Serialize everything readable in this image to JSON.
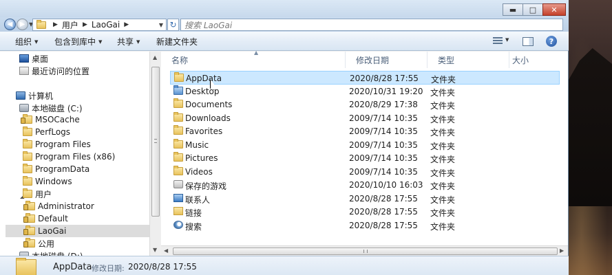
{
  "window": {
    "minimize_glyph": "▬",
    "maximize_glyph": "□",
    "close_glyph": "✕"
  },
  "address": {
    "segments": [
      "用户",
      "LaoGai"
    ],
    "search_placeholder": "搜索 LaoGai"
  },
  "toolbar": {
    "organize": "组织",
    "include_in_library": "包含到库中",
    "share": "共享",
    "new_folder": "新建文件夹",
    "help_glyph": "?"
  },
  "nav": {
    "items": [
      {
        "label": "桌面",
        "icon": "desktop-icon"
      },
      {
        "label": "最近访问的位置",
        "icon": "recent-places-icon"
      },
      {
        "label": "计算机",
        "icon": "computer-icon"
      },
      {
        "label": "本地磁盘 (C:)",
        "icon": "drive-icon"
      },
      {
        "label": "MSOCache",
        "icon": "locked-folder-icon"
      },
      {
        "label": "PerfLogs",
        "icon": "folder-icon"
      },
      {
        "label": "Program Files",
        "icon": "folder-icon"
      },
      {
        "label": "Program Files (x86)",
        "icon": "folder-icon"
      },
      {
        "label": "ProgramData",
        "icon": "folder-icon"
      },
      {
        "label": "Windows",
        "icon": "folder-icon"
      },
      {
        "label": "用户",
        "icon": "folder-icon"
      },
      {
        "label": "Administrator",
        "icon": "locked-folder-icon"
      },
      {
        "label": "Default",
        "icon": "locked-folder-icon"
      },
      {
        "label": "LaoGai",
        "icon": "locked-folder-icon"
      },
      {
        "label": "公用",
        "icon": "locked-folder-icon"
      },
      {
        "label": "本地磁盘 (D:)",
        "icon": "drive-icon"
      }
    ]
  },
  "columns": {
    "name": "名称",
    "date": "修改日期",
    "type": "类型",
    "size": "大小"
  },
  "files": [
    {
      "name": "AppData",
      "date": "2020/8/28 17:55",
      "type": "文件夹",
      "icon": "folder-icon",
      "selected": true
    },
    {
      "name": "Desktop",
      "date": "2020/10/31 19:20",
      "type": "文件夹",
      "icon": "desktop-folder-icon"
    },
    {
      "name": "Documents",
      "date": "2020/8/29 17:38",
      "type": "文件夹",
      "icon": "folder-icon"
    },
    {
      "name": "Downloads",
      "date": "2009/7/14 10:35",
      "type": "文件夹",
      "icon": "folder-icon"
    },
    {
      "name": "Favorites",
      "date": "2009/7/14 10:35",
      "type": "文件夹",
      "icon": "folder-icon"
    },
    {
      "name": "Music",
      "date": "2009/7/14 10:35",
      "type": "文件夹",
      "icon": "folder-icon"
    },
    {
      "name": "Pictures",
      "date": "2009/7/14 10:35",
      "type": "文件夹",
      "icon": "folder-icon"
    },
    {
      "name": "Videos",
      "date": "2009/7/14 10:35",
      "type": "文件夹",
      "icon": "folder-icon"
    },
    {
      "name": "保存的游戏",
      "date": "2020/10/10 16:03",
      "type": "文件夹",
      "icon": "saved-games-icon"
    },
    {
      "name": "联系人",
      "date": "2020/8/28 17:55",
      "type": "文件夹",
      "icon": "contacts-icon"
    },
    {
      "name": "链接",
      "date": "2020/8/28 17:55",
      "type": "文件夹",
      "icon": "links-icon"
    },
    {
      "name": "搜索",
      "date": "2020/8/28 17:55",
      "type": "文件夹",
      "icon": "searches-icon"
    }
  ],
  "details": {
    "name": "AppData",
    "modified_label": "修改日期:",
    "modified_value": "2020/8/28 17:55"
  }
}
